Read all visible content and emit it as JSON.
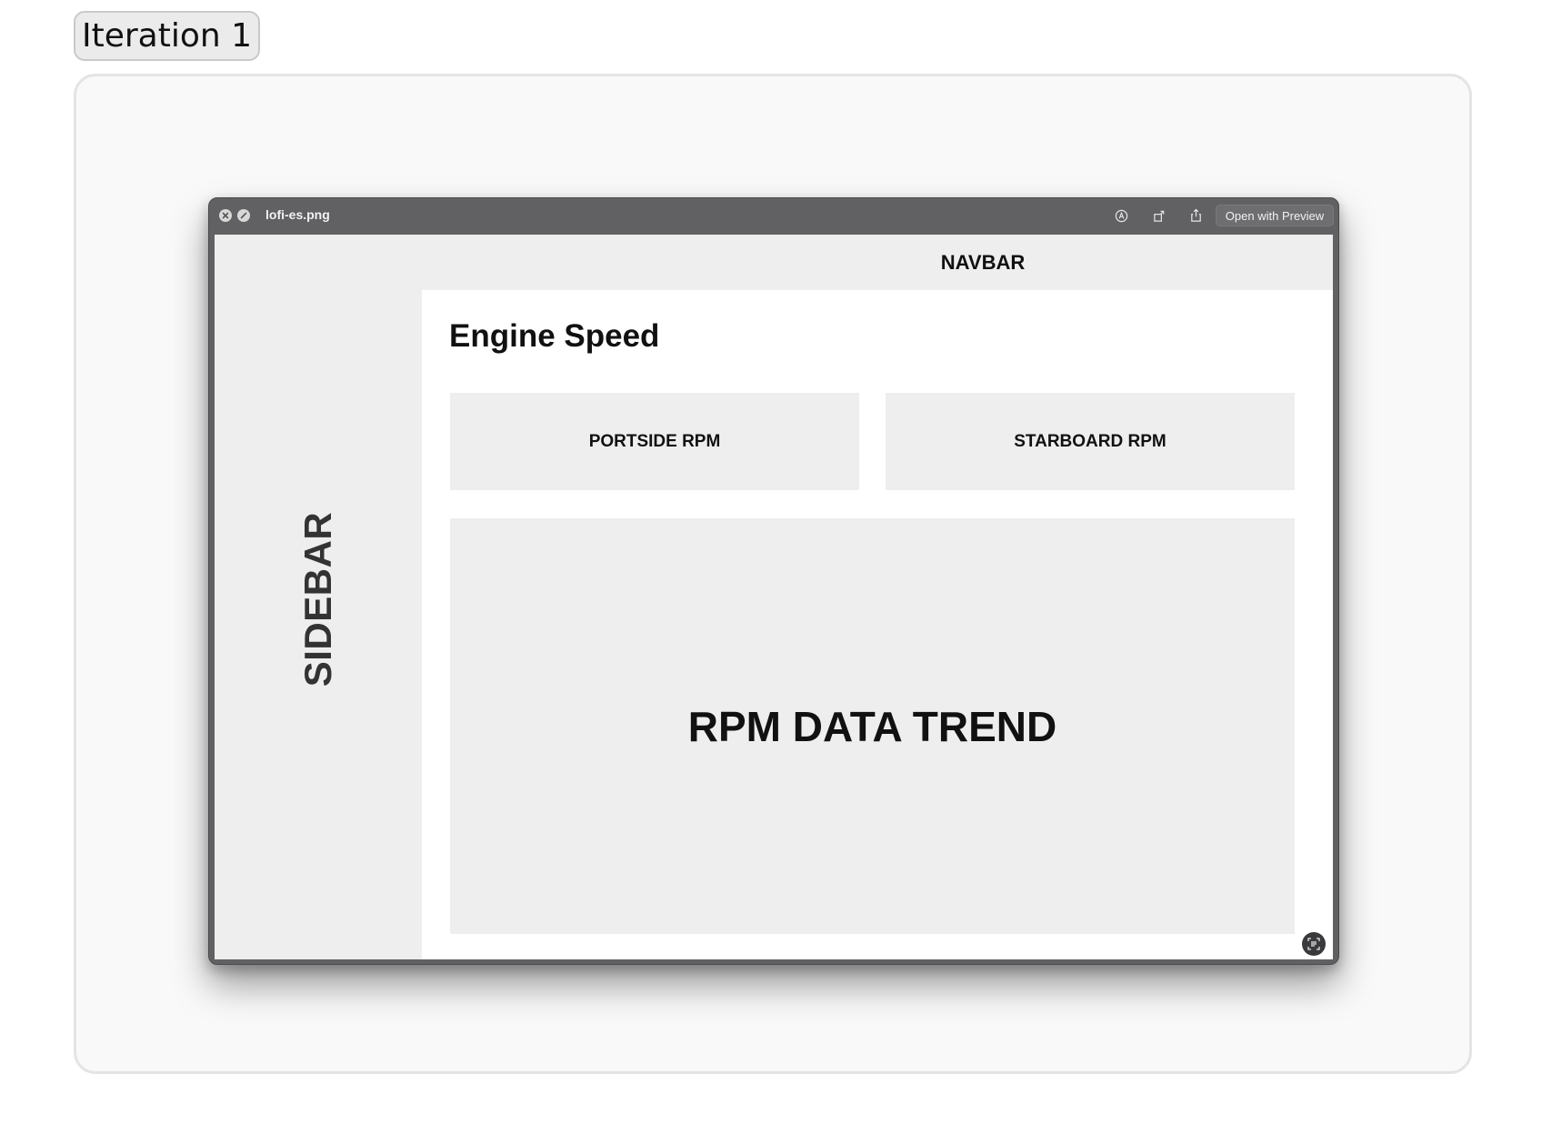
{
  "iteration": {
    "label": "Iteration 1"
  },
  "window": {
    "filename": "lofi-es.png",
    "open_button_label": "Open with Preview",
    "toolbar_icons": [
      "markup-icon",
      "rotate-icon",
      "share-icon"
    ]
  },
  "mockup": {
    "navbar_label": "NAVBAR",
    "sidebar_label": "SIDEBAR",
    "title": "Engine Speed",
    "cards": {
      "portside": "PORTSIDE RPM",
      "starboard": "STARBOARD RPM",
      "trend": "RPM DATA TREND"
    }
  },
  "colors": {
    "window_chrome": "#616163",
    "placeholder_fill": "#eeeeee",
    "panel_bg": "#f9f9f9"
  }
}
